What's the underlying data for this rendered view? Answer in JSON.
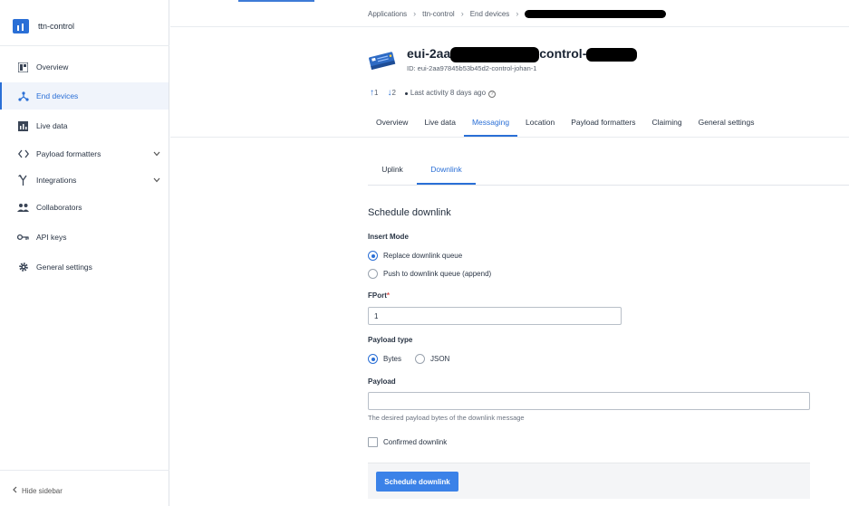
{
  "sidebar": {
    "app_name": "ttn-control",
    "items": [
      {
        "label": "Overview",
        "icon": "grid-icon"
      },
      {
        "label": "End devices",
        "icon": "device-branch-icon"
      },
      {
        "label": "Live data",
        "icon": "bar-chart-icon"
      },
      {
        "label": "Payload formatters",
        "icon": "code-icon"
      },
      {
        "label": "Integrations",
        "icon": "merge-icon"
      },
      {
        "label": "Collaborators",
        "icon": "people-icon"
      },
      {
        "label": "API keys",
        "icon": "key-icon"
      },
      {
        "label": "General settings",
        "icon": "gear-icon"
      }
    ],
    "active_index": 1,
    "hide_label": "Hide sidebar"
  },
  "breadcrumb": {
    "items": [
      "Applications",
      "ttn-control",
      "End devices"
    ]
  },
  "device": {
    "title_visible_start": "eui-2aa",
    "title_visible_end": "control-",
    "id_line": "ID: eui-2aa97845b53b45d2-control-johan-1",
    "uplinks": "1",
    "downlinks": "2",
    "last_activity": "Last activity 8 days ago"
  },
  "tabs": [
    "Overview",
    "Live data",
    "Messaging",
    "Location",
    "Payload formatters",
    "Claiming",
    "General settings"
  ],
  "active_tab": "Messaging",
  "subtabs": [
    "Uplink",
    "Downlink"
  ],
  "active_subtab": "Downlink",
  "form": {
    "title": "Schedule downlink",
    "insert_mode_label": "Insert Mode",
    "insert_options": [
      "Replace downlink queue",
      "Push to downlink queue (append)"
    ],
    "insert_selected": 0,
    "fport_label": "FPort",
    "fport_required": "*",
    "fport_value": "1",
    "payload_type_label": "Payload type",
    "payload_type_options": [
      "Bytes",
      "JSON"
    ],
    "payload_type_selected": 0,
    "payload_label": "Payload",
    "payload_value": "",
    "payload_hint": "The desired payload bytes of the downlink message",
    "confirmed_label": "Confirmed downlink",
    "confirmed_checked": false,
    "submit_label": "Schedule downlink"
  },
  "colors": {
    "accent": "#2a6fd6",
    "button": "#3b82e8"
  }
}
